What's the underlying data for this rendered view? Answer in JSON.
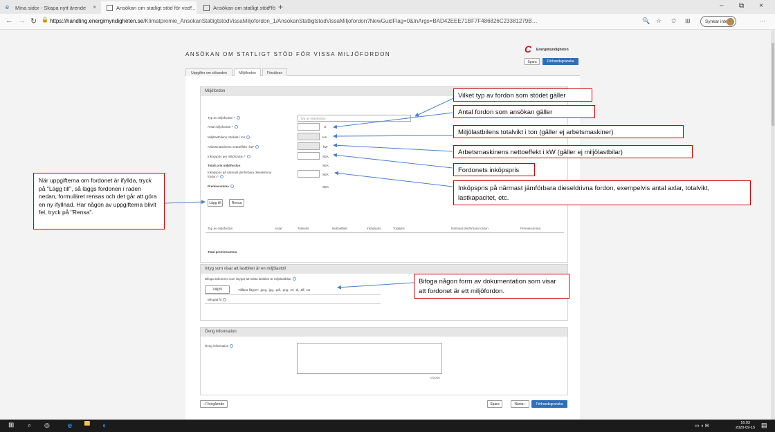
{
  "browser": {
    "tabs": [
      {
        "title": "Mina sidor - Skapa nytt ärende",
        "close": "×"
      },
      {
        "title": "Ansökan om statligt stöd för viss…",
        "close": "×"
      },
      {
        "title": "Ansökan om statligt stöd för viss…",
        "close": "×"
      }
    ],
    "new_tab": "+",
    "window_controls": {
      "minimize": "–",
      "restore": "⧉",
      "close": "×"
    },
    "url_domain": "https://handling.energimyndigheten.se",
    "url_path": "/Klimatpremie_AnsokanStatligtstodVissaMiljofordon_1/AnsokanStatligtstodVissaMiljofordon?NewGuidFlag=0&InArgs=BAD42EEE71BF7F486826C23381279B…",
    "sync_label": "Synkar inte",
    "more": "···",
    "nav": {
      "back": "←",
      "forward": "→",
      "refresh": "↻"
    }
  },
  "form": {
    "title": "ANSÖKAN OM STATLIGT STÖD FÖR VISSA MILJÖFORDON",
    "logo_text": "Energimyndigheten",
    "save_label": "Spara",
    "preview_label": "Förhandsgranska",
    "tabs": [
      "Uppgifter om sökanden",
      "Miljöfordon",
      "Försäkran"
    ],
    "vehicle_section": {
      "header": "Miljöfordon",
      "type_label": "Typ av miljöfordon *",
      "type_placeholder": "Typ av miljöfordon",
      "count_label": "Antal miljöfordon *",
      "count_unit": "st",
      "weight_label": "Miljölastbilens totalvikt i ton",
      "weight_unit": "ton",
      "power_label": "Arbetsmaskinens nettoeffekt i kW",
      "power_unit": "kW",
      "price_label": "Inköpspris per miljöfordon *",
      "price_unit": "SEK",
      "total_price_label": "Totalt pris miljöfordon",
      "total_price_unit": "SEK",
      "diesel_label_1": "Inköpspris på närmast jämförbara dieseldrivna",
      "diesel_label_2": "fordon *",
      "diesel_unit": "SEK",
      "premium_label": "Premiesumma",
      "premium_unit": "SEK",
      "add_button": "Lägg till",
      "clear_button": "Rensa",
      "table_headers": [
        "Typ av miljöfordon",
        "Antal",
        "Totalvikt",
        "Nettoeffekt",
        "Inköpspris",
        "Totalpris",
        "Närmast jämförbara fordon",
        "Premiesumma"
      ],
      "total_premium_label": "Total premiesumma"
    },
    "certificate_section": {
      "header": "Intyg som visar att lastbilen är en miljölastbil",
      "attach_label": "Bifoga dokument som intygar att sökta lastbilar är miljölastbilar",
      "choose_file": "Välj fil",
      "allowed_types": "Tillåtna filtyper: .jpeg, .jpg, .pdf, .png, .rtf, .tif, .tiff, .txt",
      "attached_label": "Bifogad fil"
    },
    "other_section": {
      "header": "Övrig information",
      "field_label": "Övrig information",
      "char_counter": "0/2000"
    },
    "bottom": {
      "previous": "‹ Föregående",
      "save": "Spara",
      "next": "Nästa ›",
      "preview": "Förhandsgranska"
    }
  },
  "annotations": {
    "type": "Vilket typ av fordon som stödet gäller",
    "count": "Antal fordon som ansökan gäller",
    "weight": "Miljölastbilens totalvikt i ton (gäller ej arbetsmaskiner)",
    "power": "Arbetsmaskinens nettoeffekt i kW (gäller ej miljölastbilar)",
    "price": "Fordonets inköpspris",
    "diesel": "Inköpspris på närmast jämförbara dieseldrivna fordon, exempelvis antal axlar, totalvikt, lastkapacitet, etc.",
    "add_help": "När uppgifterna om fordonet är ifyllda, tryck på \"Lägg till\", så läggs fordonen i raden nedan, formuläret rensas och det går att göra en ny ifyllnad. Har någon av uppgifterna blivit fel, tryck på \"Rensa\".",
    "attach_help": "Bifoga någon form av dokumentation som visar att fordonet är ett miljöfordon."
  },
  "taskbar": {
    "time": "16:03",
    "date": "2020-09-15"
  },
  "colors": {
    "accent": "#2f6fb7",
    "annotation_border": "#cc0000",
    "annotation_arrow": "#4a7ed0",
    "brand_red": "#c0171d"
  }
}
